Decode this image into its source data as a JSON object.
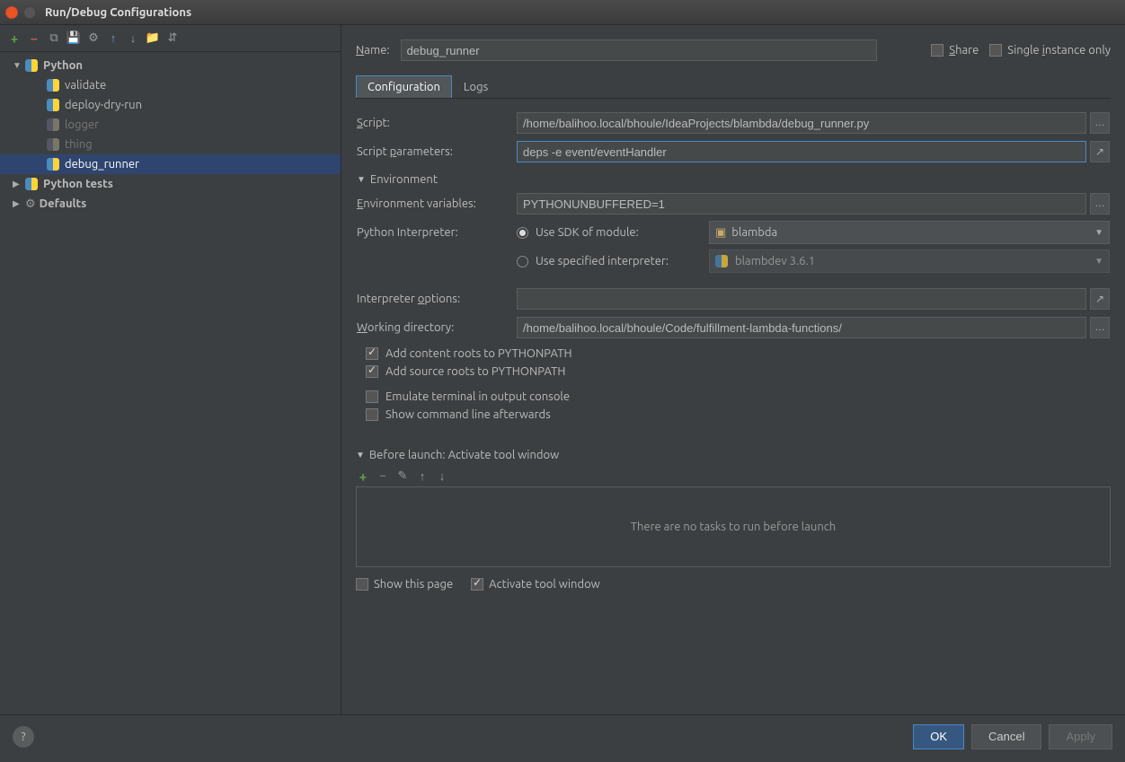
{
  "window": {
    "title": "Run/Debug Configurations"
  },
  "sidebar": {
    "items": [
      {
        "label": "Python",
        "expanded": true,
        "children": [
          {
            "label": "validate"
          },
          {
            "label": "deploy-dry-run"
          },
          {
            "label": "logger",
            "dim": true
          },
          {
            "label": "thing",
            "dim": true
          },
          {
            "label": "debug_runner",
            "selected": true
          }
        ]
      },
      {
        "label": "Python tests"
      },
      {
        "label": "Defaults"
      }
    ]
  },
  "header": {
    "name_label": "Name:",
    "name_value": "debug_runner",
    "share": "Share",
    "single_instance": "Single instance only"
  },
  "tabs": {
    "config": "Configuration",
    "logs": "Logs"
  },
  "form": {
    "script_label": "Script:",
    "script_value": "/home/balihoo.local/bhoule/IdeaProjects/blambda/debug_runner.py",
    "params_label": "Script parameters:",
    "params_value": "deps -e event/eventHandler",
    "env_section": "Environment",
    "envvars_label": "Environment variables:",
    "envvars_value": "PYTHONUNBUFFERED=1",
    "interpreter_label": "Python Interpreter:",
    "use_sdk_label": "Use SDK of module:",
    "sdk_module": "blambda",
    "use_spec_label": "Use specified interpreter:",
    "spec_interpreter": "blambdev 3.6.1",
    "interp_opts_label": "Interpreter options:",
    "interp_opts_value": "",
    "workdir_label": "Working directory:",
    "workdir_value": "/home/balihoo.local/bhoule/Code/fulfillment-lambda-functions/",
    "add_content": "Add content roots to PYTHONPATH",
    "add_source": "Add source roots to PYTHONPATH",
    "emulate": "Emulate terminal in output console",
    "show_cmd": "Show command line afterwards"
  },
  "before": {
    "section": "Before launch: Activate tool window",
    "empty": "There are no tasks to run before launch",
    "show_page": "Show this page",
    "activate": "Activate tool window"
  },
  "footer": {
    "ok": "OK",
    "cancel": "Cancel",
    "apply": "Apply"
  }
}
